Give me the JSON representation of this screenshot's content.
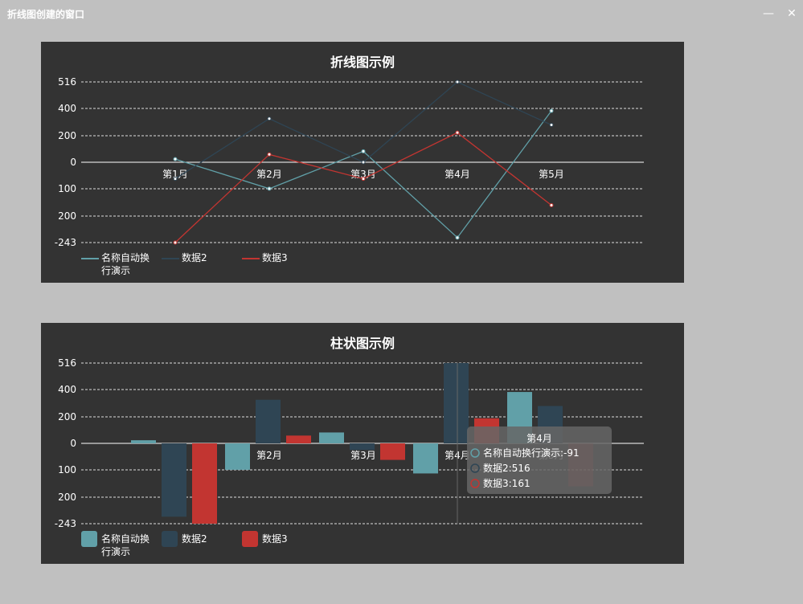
{
  "window": {
    "title": "折线图创建的窗口",
    "minimize_glyph": "—",
    "close_glyph": "✕"
  },
  "colors": {
    "series1": "#61a0a8",
    "series2": "#2f4554",
    "series3": "#c23531",
    "background": "#333333"
  },
  "chart_data": [
    {
      "type": "line",
      "title": "折线图示例",
      "categories": [
        "第1月",
        "第2月",
        "第3月",
        "第4月",
        "第5月"
      ],
      "y_tick_labels": [
        "516",
        "400",
        "200",
        "0",
        "100",
        "200",
        "-243"
      ],
      "ylim": [
        -243,
        516
      ],
      "grid": true,
      "legend_position": "bottom-left",
      "series": [
        {
          "name": "名称自动换行演示",
          "values": [
            20,
            -80,
            70,
            -228,
            330
          ]
        },
        {
          "name": "数据2",
          "values": [
            -50,
            280,
            0,
            516,
            240
          ]
        },
        {
          "name": "数据3",
          "values": [
            -243,
            50,
            -50,
            190,
            -130
          ]
        }
      ]
    },
    {
      "type": "bar",
      "title": "柱状图示例",
      "categories": [
        "第1月",
        "第2月",
        "第3月",
        "第4月",
        "第5月"
      ],
      "y_tick_labels": [
        "516",
        "400",
        "200",
        "0",
        "100",
        "200",
        "-243"
      ],
      "ylim": [
        -243,
        516
      ],
      "grid": true,
      "legend_position": "bottom-left",
      "series": [
        {
          "name": "名称自动换行演示",
          "values": [
            20,
            -80,
            70,
            -91,
            330
          ]
        },
        {
          "name": "数据2",
          "values": [
            -222,
            280,
            -20,
            516,
            240
          ]
        },
        {
          "name": "数据3",
          "values": [
            -243,
            50,
            -50,
            161,
            -130
          ]
        }
      ],
      "tooltip": {
        "title": "第4月",
        "rows": [
          "名称自动换行演示:-91",
          "数据2:516",
          "数据3:161"
        ]
      }
    }
  ]
}
